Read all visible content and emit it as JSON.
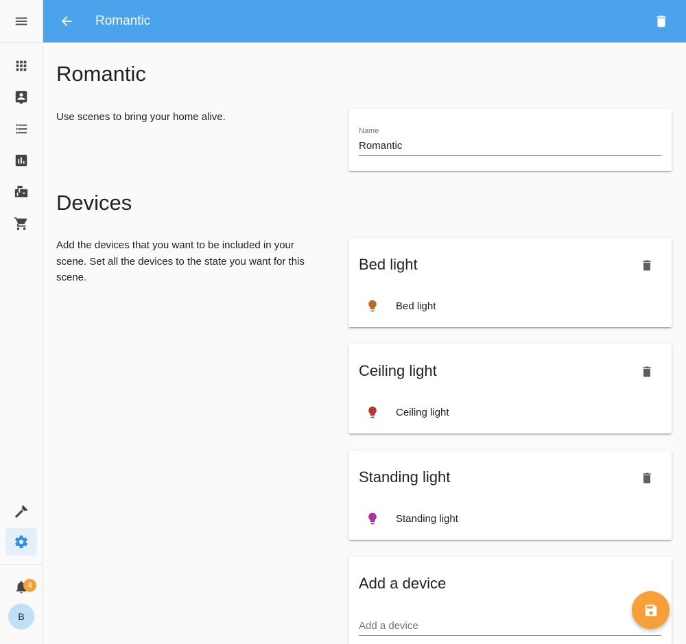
{
  "header": {
    "title": "Romantic"
  },
  "page": {
    "title": "Romantic",
    "intro": "Use scenes to bring your home alive.",
    "name_field": {
      "label": "Name",
      "value": "Romantic"
    }
  },
  "devices_section": {
    "title": "Devices",
    "description": "Add the devices that you want to be included in your scene. Set all the devices to the state you want for this scene.",
    "devices": [
      {
        "name": "Bed light",
        "entity": "Bed light",
        "color": "#b56c23"
      },
      {
        "name": "Ceiling light",
        "entity": "Ceiling light",
        "color": "#b23a2c"
      },
      {
        "name": "Standing light",
        "entity": "Standing light",
        "color": "#a8369c"
      }
    ],
    "add_device": {
      "title": "Add a device",
      "placeholder": "Add a device"
    }
  },
  "sidebar": {
    "items": [
      {
        "icon": "apps-icon"
      },
      {
        "icon": "account-box-icon"
      },
      {
        "icon": "format-list-icon"
      },
      {
        "icon": "chart-bar-icon"
      },
      {
        "icon": "mailbox-icon"
      },
      {
        "icon": "cart-icon"
      }
    ],
    "bottom": [
      {
        "icon": "hammer-icon"
      },
      {
        "icon": "settings-icon",
        "active": true
      }
    ],
    "notifications_count": "4",
    "user_initial": "B"
  },
  "colors": {
    "primary": "#4aa3eb",
    "accent": "#f7a03a"
  }
}
